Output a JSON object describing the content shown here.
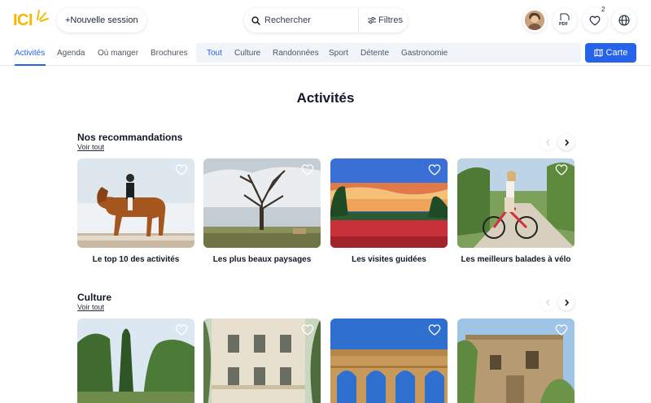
{
  "header": {
    "logo_text": "ICI",
    "new_session_label": "+Nouvelle session",
    "search_label": "Rechercher",
    "filters_label": "Filtres",
    "pdf_label": "PDF",
    "favorites_count": "2"
  },
  "nav": {
    "items": [
      {
        "label": "Activités"
      },
      {
        "label": "Agenda"
      },
      {
        "label": "Où manger"
      },
      {
        "label": "Brochures"
      }
    ],
    "categories": [
      {
        "label": "Tout"
      },
      {
        "label": "Culture"
      },
      {
        "label": "Randonnées"
      },
      {
        "label": "Sport"
      },
      {
        "label": "Détente"
      },
      {
        "label": "Gastronomie"
      }
    ],
    "map_button_label": "Carte"
  },
  "page": {
    "title": "Activités"
  },
  "sections": [
    {
      "title": "Nos recommandations",
      "see_all": "Voir tout",
      "cards": [
        {
          "label": "Le top 10 des activités"
        },
        {
          "label": "Les plus beaux paysages"
        },
        {
          "label": "Les visites guidées"
        },
        {
          "label": "Les meilleurs balades à vélo"
        }
      ]
    },
    {
      "title": "Culture",
      "see_all": "Voir tout",
      "cards": [
        {
          "label": ""
        },
        {
          "label": ""
        },
        {
          "label": ""
        },
        {
          "label": ""
        }
      ]
    }
  ],
  "colors": {
    "accent": "#2563eb",
    "logo": "#f5b800"
  }
}
